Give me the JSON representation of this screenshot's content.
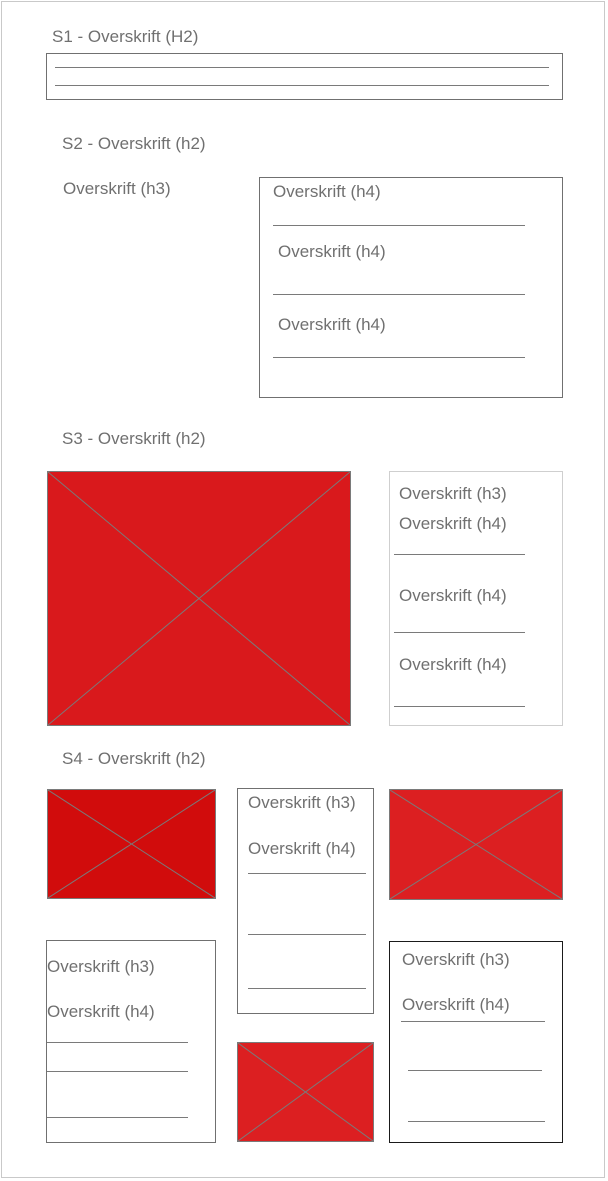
{
  "s1": {
    "title": "S1 - Overskrift (H2)"
  },
  "s2": {
    "title": "S2 - Overskrift (h2)",
    "h3": "Overskrift (h3)",
    "h4_items": [
      "Overskrift (h4)",
      "Overskrift (h4)",
      "Overskrift (h4)"
    ]
  },
  "s3": {
    "title": "S3 - Overskrift (h2)",
    "h3": "Overskrift (h3)",
    "h4_items": [
      "Overskrift (h4)",
      "Overskrift (h4)",
      "Overskrift (h4)"
    ]
  },
  "s4": {
    "title": "S4 - Overskrift (h2)",
    "card_center": {
      "h3": "Overskrift (h3)",
      "h4": "Overskrift (h4)"
    },
    "card_left": {
      "h3": "Overskrift (h3)",
      "h4": "Overskrift (h4)"
    },
    "card_right": {
      "h3": "Overskrift (h3)",
      "h4": "Overskrift (h4)"
    }
  },
  "colors": {
    "placeholder_red": "#d9191c",
    "placeholder_red_dark": "#d10c0c",
    "placeholder_red_light": "#dc1f21",
    "line_gray": "#7a7a7a"
  }
}
